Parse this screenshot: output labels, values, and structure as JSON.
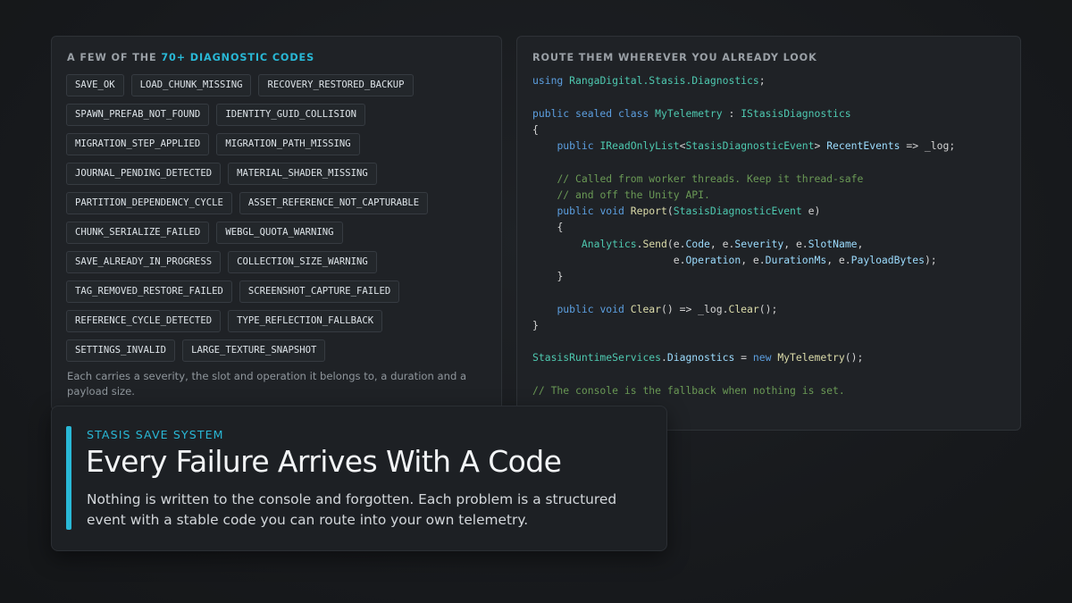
{
  "left_panel": {
    "heading_prefix": "A FEW OF THE ",
    "heading_accent": "70+ DIAGNOSTIC CODES",
    "codes": [
      "SAVE_OK",
      "LOAD_CHUNK_MISSING",
      "RECOVERY_RESTORED_BACKUP",
      "SPAWN_PREFAB_NOT_FOUND",
      "IDENTITY_GUID_COLLISION",
      "MIGRATION_STEP_APPLIED",
      "MIGRATION_PATH_MISSING",
      "JOURNAL_PENDING_DETECTED",
      "MATERIAL_SHADER_MISSING",
      "PARTITION_DEPENDENCY_CYCLE",
      "ASSET_REFERENCE_NOT_CAPTURABLE",
      "CHUNK_SERIALIZE_FAILED",
      "WEBGL_QUOTA_WARNING",
      "SAVE_ALREADY_IN_PROGRESS",
      "COLLECTION_SIZE_WARNING",
      "TAG_REMOVED_RESTORE_FAILED",
      "SCREENSHOT_CAPTURE_FAILED",
      "REFERENCE_CYCLE_DETECTED",
      "TYPE_REFLECTION_FALLBACK",
      "SETTINGS_INVALID",
      "LARGE_TEXTURE_SNAPSHOT"
    ],
    "footnote": "Each carries a severity, the slot and operation it belongs to, a duration and a payload size."
  },
  "right_panel": {
    "heading": "ROUTE THEM WHEREVER YOU ALREADY LOOK",
    "code": {
      "l1_using": "using",
      "l1_ns": "RangaDigital.Stasis.Diagnostics",
      "l1_end": ";",
      "l3_mods": "public sealed class",
      "l3_class": "MyTelemetry",
      "l3_colon": " : ",
      "l3_iface": "IStasisDiagnostics",
      "l4_brace": "{",
      "l5_public": "public",
      "l5_type": "IReadOnlyList",
      "l5_lt": "<",
      "l5_arg": "StasisDiagnosticEvent",
      "l5_gt": "> ",
      "l5_prop": "RecentEvents",
      "l5_rest": " => _log;",
      "l7_comment": "// Called from worker threads. Keep it thread-safe",
      "l8_comment": "// and off the Unity API.",
      "l9_mods": "public void",
      "l9_fn": "Report",
      "l9_open": "(",
      "l9_type": "StasisDiagnosticEvent",
      "l9_rest": " e)",
      "l10_brace": "{",
      "l11_class": "Analytics",
      "l11_dot": ".",
      "l11_fn": "Send",
      "l11_a": "(e.",
      "l11_p1": "Code",
      "l11_b": ", e.",
      "l11_p2": "Severity",
      "l11_c": ", e.",
      "l11_p3": "SlotName",
      "l11_d": ",",
      "l12_a": "e.",
      "l12_p1": "Operation",
      "l12_b": ", e.",
      "l12_p2": "DurationMs",
      "l12_c": ", e.",
      "l12_p3": "PayloadBytes",
      "l12_d": ");",
      "l13_brace": "}",
      "l15_mods": "public void",
      "l15_fn": "Clear",
      "l15_mid": "() => _log.",
      "l15_fn2": "Clear",
      "l15_end": "();",
      "l16_brace": "}",
      "l18_class": "StasisRuntimeServices",
      "l18_dot": ".",
      "l18_prop": "Diagnostics",
      "l18_eq": " = ",
      "l18_new": "new",
      "l18_ctor": "MyTelemetry",
      "l18_end": "();",
      "l20_comment": "// The console is the fallback when nothing is set."
    }
  },
  "title_card": {
    "eyebrow": "STASIS SAVE SYSTEM",
    "title": "Every Failure Arrives With A Code",
    "subtitle": "Nothing is written to the console and forgotten. Each problem is a structured event with a stable code you can route into your own telemetry."
  },
  "colors": {
    "accent": "#29b8d6",
    "keyword": "#5c9fe0",
    "type": "#4ec9b0",
    "function": "#dcdcaa",
    "property": "#9cdcfe",
    "comment": "#6a9955"
  }
}
